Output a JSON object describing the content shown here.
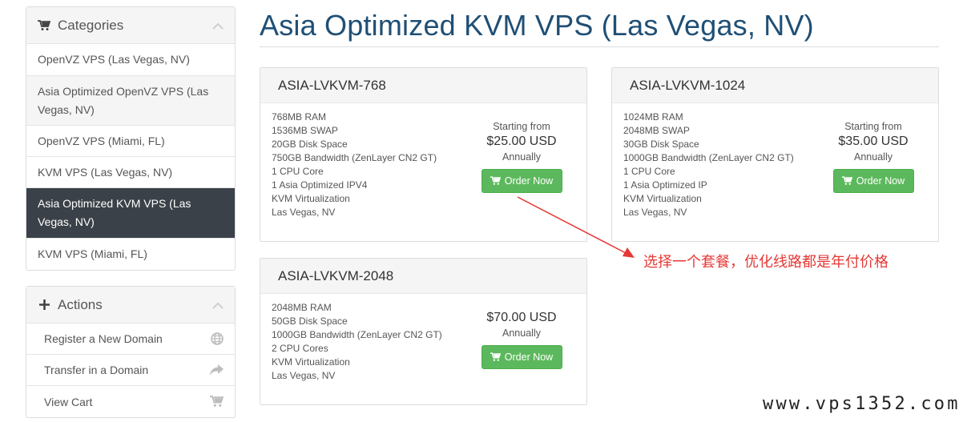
{
  "sidebar": {
    "categories": {
      "title": "Categories",
      "items": [
        {
          "label": "OpenVZ VPS (Las Vegas, NV)"
        },
        {
          "label": "Asia Optimized OpenVZ VPS (Las Vegas, NV)"
        },
        {
          "label": "OpenVZ VPS (Miami, FL)"
        },
        {
          "label": "KVM VPS (Las Vegas, NV)"
        },
        {
          "label": "Asia Optimized KVM VPS (Las Vegas, NV)"
        },
        {
          "label": "KVM VPS (Miami, FL)"
        }
      ]
    },
    "actions": {
      "title": "Actions",
      "items": [
        {
          "label": "Register a New Domain",
          "icon": "globe-icon"
        },
        {
          "label": "Transfer in a Domain",
          "icon": "share-arrow-icon"
        },
        {
          "label": "View Cart",
          "icon": "cart-icon"
        }
      ]
    }
  },
  "page": {
    "title": "Asia Optimized KVM VPS (Las Vegas, NV)"
  },
  "products": [
    {
      "name": "ASIA-LVKVM-768",
      "features": [
        "768MB RAM",
        "1536MB SWAP",
        "20GB Disk Space",
        "750GB Bandwidth (ZenLayer CN2 GT)",
        "1 CPU Core",
        "1 Asia Optimized IPV4",
        "KVM Virtualization",
        "Las Vegas, NV"
      ],
      "starting": "Starting from",
      "price": "$25.00 USD",
      "cycle": "Annually",
      "button": "Order Now"
    },
    {
      "name": "ASIA-LVKVM-1024",
      "features": [
        "1024MB RAM",
        "2048MB SWAP",
        "30GB Disk Space",
        "1000GB Bandwidth (ZenLayer CN2 GT)",
        "1 CPU Core",
        "1 Asia Optimized IP",
        "KVM Virtualization",
        "Las Vegas, NV"
      ],
      "starting": "Starting from",
      "price": "$35.00 USD",
      "cycle": "Annually",
      "button": "Order Now"
    },
    {
      "name": "ASIA-LVKVM-2048",
      "features": [
        "2048MB RAM",
        "50GB Disk Space",
        "1000GB Bandwidth (ZenLayer CN2 GT)",
        "2 CPU Cores",
        "KVM Virtualization",
        "Las Vegas, NV"
      ],
      "price": "$70.00 USD",
      "cycle": "Annually",
      "button": "Order Now"
    }
  ],
  "annotation": {
    "text": "选择一个套餐，优化线路都是年付价格",
    "color": "#e53935"
  },
  "watermark": {
    "text": "www.vps1352.com"
  },
  "colors": {
    "title": "#1f4f75",
    "active_item": "#3b4148",
    "order_button": "#5cb85c"
  }
}
